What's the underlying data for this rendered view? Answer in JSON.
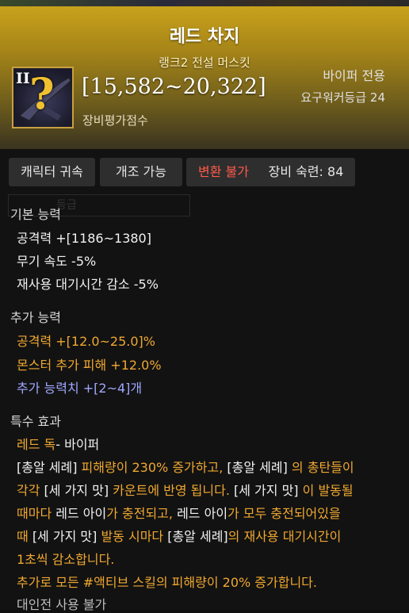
{
  "item": {
    "name": "레드 차지",
    "subtitle": "랭크2 전설 머스킷",
    "grade_mark": "II",
    "icon_glyph": "?",
    "score": "[15,582~20,322]",
    "score_label": "장비평가점수",
    "class_only": "바이퍼 전용",
    "required_level": "요구워커등급 24"
  },
  "tags": [
    {
      "label": "캐릭터 귀속"
    },
    {
      "label": "개조 가능"
    },
    {
      "label": "변환 불가"
    },
    {
      "label": "장비 숙련: 84"
    }
  ],
  "base_stats": {
    "title": "기본 능력",
    "lines": [
      "공격력  +[1186~1380]",
      "무기 속도 -5%",
      "재사용 대기시간 감소 -5%"
    ]
  },
  "extra_stats": {
    "title": "추가 능력",
    "lines": [
      "공격력  +[12.0~25.0]%",
      "몬스터 추가 피해  +12.0%",
      "추가 능력치 +[2~4]개"
    ]
  },
  "special": {
    "title": "특수 효과",
    "name": "레드 독",
    "name_suffix": "- 바이퍼",
    "l1": {
      "a": "[총알 세례]",
      "b": " 피해량이 230% 증가하고, ",
      "c": "[총알 세례]",
      "d": " 의 총탄들이"
    },
    "l2": {
      "a": "각각 ",
      "b": "[세 가지 맛]",
      "c": " 카운트에 반영 됩니다. ",
      "d": "[세 가지 맛]",
      "e": " 이 발동될"
    },
    "l3": {
      "a": "때마다 ",
      "b": "레드 아이",
      "c": "가 충전되고, ",
      "d": "레드 아이",
      "e": "가 모두 충전되어있을"
    },
    "l4": {
      "a": "때 ",
      "b": "[세 가지 맛]",
      "c": " 발동 시마다 ",
      "d": "[총알 세례]",
      "e": "의 재사용 대기시간이"
    },
    "l5": "1초씩 감소합니다.",
    "l6": "추가로 모든 #액티브 스킬의 피해량이 20% 증가합니다.",
    "pvp": "대인전 사용 불가"
  },
  "ghost_filter": "등급",
  "colors": {
    "header_gold": "#c8a21c",
    "effect_orange": "#f0a830",
    "stat_purple": "#a0a8ff",
    "tag_red": "#ff5a4a"
  }
}
